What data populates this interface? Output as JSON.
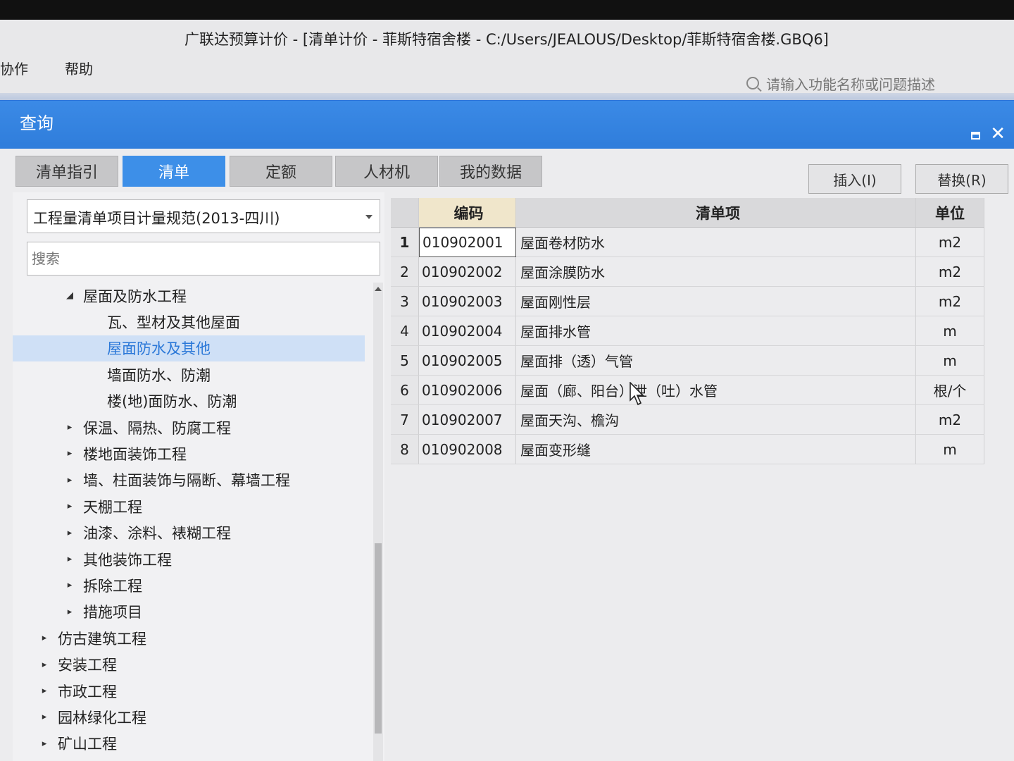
{
  "window": {
    "title": "广联达预算计价 - [清单计价 - 菲斯特宿舍楼 - C:/Users/JEALOUS/Desktop/菲斯特宿舍楼.GBQ6]",
    "help_search_placeholder": "请输入功能名称或问题描述"
  },
  "menu": [
    "协作",
    "帮助"
  ],
  "dialog": {
    "title": "查询",
    "tabs": [
      "清单指引",
      "清单",
      "定额",
      "人材机",
      "我的数据"
    ],
    "active_tab": "清单",
    "buttons": {
      "insert": "插入(I)",
      "replace": "替换(R)"
    }
  },
  "left_panel": {
    "spec_select": "工程量清单项目计量规范(2013-四川)",
    "search_placeholder": "搜索",
    "tree": [
      {
        "label": "屋面及防水工程",
        "level": 1,
        "expanded": true
      },
      {
        "label": "瓦、型材及其他屋面",
        "level": 2
      },
      {
        "label": "屋面防水及其他",
        "level": 2,
        "selected": true
      },
      {
        "label": "墙面防水、防潮",
        "level": 2
      },
      {
        "label": "楼(地)面防水、防潮",
        "level": 2
      },
      {
        "label": "保温、隔热、防腐工程",
        "level": 1
      },
      {
        "label": "楼地面装饰工程",
        "level": 1
      },
      {
        "label": "墙、柱面装饰与隔断、幕墙工程",
        "level": 1
      },
      {
        "label": "天棚工程",
        "level": 1
      },
      {
        "label": "油漆、涂料、裱糊工程",
        "level": 1
      },
      {
        "label": "其他装饰工程",
        "level": 1
      },
      {
        "label": "拆除工程",
        "level": 1
      },
      {
        "label": "措施项目",
        "level": 1
      },
      {
        "label": "仿古建筑工程",
        "level": 0
      },
      {
        "label": "安装工程",
        "level": 0
      },
      {
        "label": "市政工程",
        "level": 0
      },
      {
        "label": "园林绿化工程",
        "level": 0
      },
      {
        "label": "矿山工程",
        "level": 0
      }
    ]
  },
  "grid": {
    "headers": {
      "code": "编码",
      "name": "清单项",
      "unit": "单位"
    },
    "rows": [
      {
        "idx": "1",
        "code": "010902001",
        "name": "屋面卷材防水",
        "unit": "m2"
      },
      {
        "idx": "2",
        "code": "010902002",
        "name": "屋面涂膜防水",
        "unit": "m2"
      },
      {
        "idx": "3",
        "code": "010902003",
        "name": "屋面刚性层",
        "unit": "m2"
      },
      {
        "idx": "4",
        "code": "010902004",
        "name": "屋面排水管",
        "unit": "m"
      },
      {
        "idx": "5",
        "code": "010902005",
        "name": "屋面排（透）气管",
        "unit": "m"
      },
      {
        "idx": "6",
        "code": "010902006",
        "name": "屋面（廊、阳台）泄（吐）水管",
        "unit": "根/个"
      },
      {
        "idx": "7",
        "code": "010902007",
        "name": "屋面天沟、檐沟",
        "unit": "m2"
      },
      {
        "idx": "8",
        "code": "010902008",
        "name": "屋面变形缝",
        "unit": "m"
      }
    ]
  }
}
